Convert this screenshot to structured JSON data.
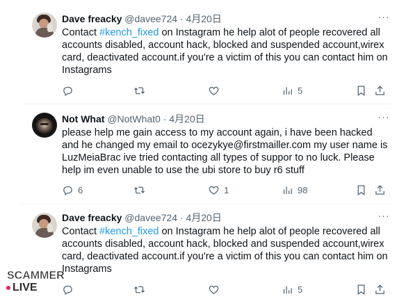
{
  "tweets": [
    {
      "name": "Dave freacky",
      "handle": "@davee724",
      "sep": "·",
      "date": "4月20日",
      "more": "···",
      "text_before": "Contact ",
      "hashtag": "#kench_fixed",
      "text_after": " on Instagram he help alot  of people recovered all accounts disabled, account hack, blocked and suspended account,wirex card, deactivated account.if you're a victim of this you can contact him on Instagrams",
      "replies": "",
      "reposts": "",
      "likes": "",
      "views": "5"
    },
    {
      "name": "Not What",
      "handle": "@NotWhat0",
      "sep": "·",
      "date": "4月20日",
      "more": "···",
      "text": "please help me gain access to my account again, i have been hacked and he changed my email to ocezykye@firstmailler.com my user name is LuzMeiaBrac ive tried contacting all types of suppor to no luck. Please help im even unable to use the ubi store to buy r6 stuff",
      "replies": "6",
      "reposts": "",
      "likes": "1",
      "views": "98"
    },
    {
      "name": "Dave freacky",
      "handle": "@davee724",
      "sep": "·",
      "date": "4月20日",
      "more": "···",
      "text_before": "Contact ",
      "hashtag": "#kench_fixed",
      "text_after": " on Instagram he help alot  of people recovered all accounts disabled, account hack, blocked and suspended account,wirex card, deactivated account.if you're a victim of this you can contact him on Instagrams",
      "replies": "",
      "reposts": "",
      "likes": "",
      "views": "5"
    }
  ],
  "watermark": {
    "line1": "SCAMMER",
    "line2": "LIVE"
  },
  "icons": [
    "reply-icon",
    "repost-icon",
    "like-icon",
    "views-icon",
    "bookmark-icon",
    "share-icon"
  ],
  "colors": {
    "link": "#1d9bf0",
    "secondary": "#536471",
    "text": "#0f1419",
    "divider": "#eff3f4"
  }
}
